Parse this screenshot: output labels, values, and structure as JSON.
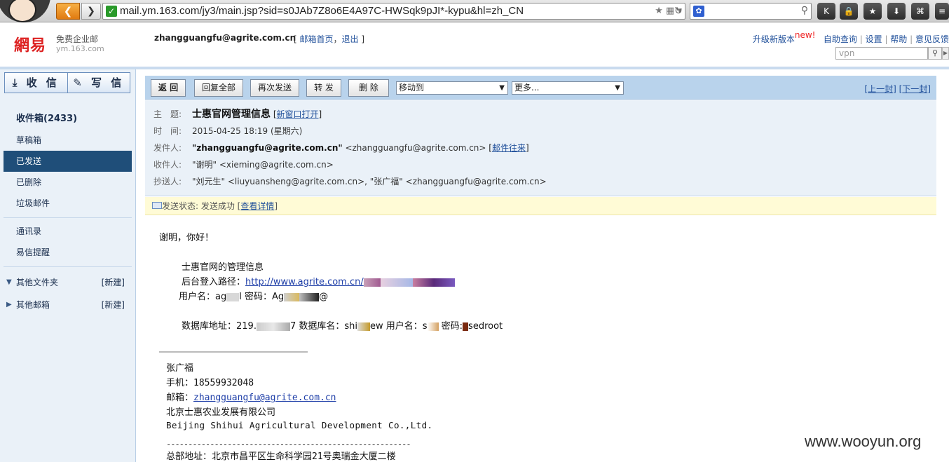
{
  "browser": {
    "url": "mail.ym.163.com/jy3/main.jsp?sid=s0JAb7Z8o6E4A97C-HWSqk9pJI*-kypu&hl=zh_CN",
    "back_glyph": "❮",
    "forward_glyph": "❯",
    "search_placeholder": ""
  },
  "header": {
    "logo_mark": "網易",
    "logo_sub": "免费企业邮",
    "logo_url": "ym.163.com",
    "user_email": "zhangguangfu@agrite.com.cn",
    "mailbox_home": "邮箱首页",
    "logout": "退出",
    "upgrade": "升级新版本",
    "upgrade_new": "new!",
    "self_help": "自助查询",
    "settings": "设置",
    "help": "帮助",
    "feedback": "意见反馈",
    "search_value": "vpn"
  },
  "sidebar": {
    "receive": "收 信",
    "compose": "写 信",
    "folders": [
      {
        "label": "收件箱(2433)"
      },
      {
        "label": "草稿箱"
      },
      {
        "label": "已发送"
      },
      {
        "label": "已删除"
      },
      {
        "label": "垃圾邮件"
      }
    ],
    "tools": [
      {
        "label": "通讯录"
      },
      {
        "label": "易信提醒"
      }
    ],
    "other_folders": "其他文件夹",
    "other_mailboxes": "其他邮箱",
    "new_label": "[新建]"
  },
  "toolbar": {
    "back": "返 回",
    "reply_all": "回复全部",
    "resend": "再次发送",
    "forward": "转 发",
    "delete": "删 除",
    "move_to": "移动到",
    "more": "更多...",
    "prev": "上一封",
    "next": "下一封"
  },
  "message": {
    "subject_key": "主　题:",
    "subject": "士惠官网管理信息",
    "open_new": "新窗口打开",
    "time_key": "时　间:",
    "time": "2015-04-25 18:19 (星期六)",
    "from_key": "发件人:",
    "from_name": "\"zhangguangfu@agrite.com.cn\"",
    "from_addr": "<zhangguangfu@agrite.com.cn>",
    "mail_history": "邮件往来",
    "to_key": "收件人:",
    "to": "\"谢明\" <xieming@agrite.com.cn>",
    "cc_key": "抄送人:",
    "cc": "\"刘元生\" <liuyuansheng@agrite.com.cn>, \"张广福\" <zhangguangfu@agrite.com.cn>",
    "status_prefix": "发送状态: 发送成功",
    "status_detail": "查看详情"
  },
  "body": {
    "greeting": "谢明，你好！",
    "line1": "士惠官网的管理信息",
    "line2_prefix": "后台登入路径：",
    "line2_link": "http://www.agrite.com.cn/",
    "line3_a": "用户名：ag",
    "line3_b": "l 密码：Ag",
    "line3_c": "@",
    "line4_a": "数据库地址：219.",
    "line4_b": "7 数据库名：shi",
    "line4_c": "ew  用户名：s",
    "line4_d": " 密码:",
    "line4_e": "sedroot"
  },
  "signature": {
    "name": "张广福",
    "mobile": "手机：18559932048",
    "email_label": "邮箱：",
    "email": "zhangguangfu@agrite.com.cn",
    "company_cn": "北京士惠农业发展有限公司",
    "company_en": "Beijing Shihui Agricultural Development Co.,Ltd.",
    "divider": "--------------------------------------------------------",
    "address": "总部地址：北京市昌平区生命科学园21号奥瑞金大厦二楼"
  },
  "watermark": "www.wooyun.org"
}
